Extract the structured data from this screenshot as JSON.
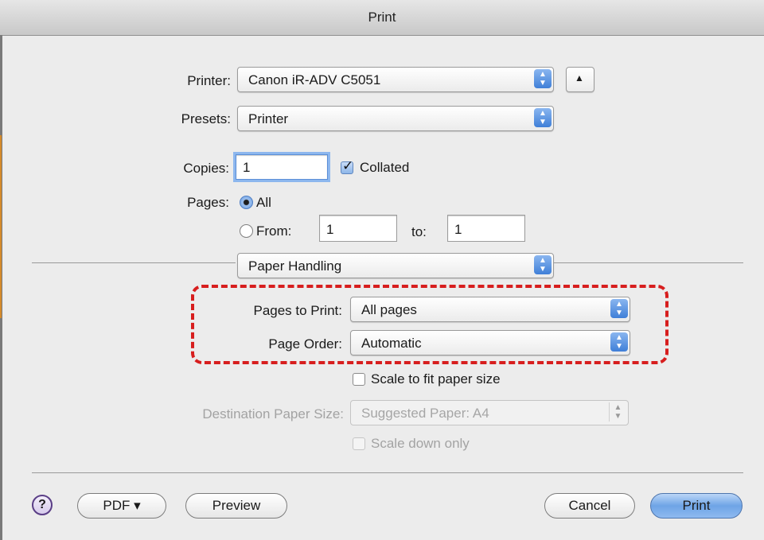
{
  "window": {
    "title": "Print"
  },
  "printer": {
    "label": "Printer:",
    "value": "Canon iR-ADV C5051",
    "disclosure_glyph": "▲"
  },
  "presets": {
    "label": "Presets:",
    "value": "Printer"
  },
  "copies": {
    "label": "Copies:",
    "value": "1",
    "collated_label": "Collated",
    "collated_checked": true
  },
  "pages": {
    "label": "Pages:",
    "all_label": "All",
    "from_label": "From:",
    "from_value": "1",
    "to_label": "to:",
    "to_value": "1",
    "selected": "All"
  },
  "panel": {
    "value": "Paper Handling"
  },
  "paper_handling": {
    "pages_to_print_label": "Pages to Print:",
    "pages_to_print_value": "All pages",
    "page_order_label": "Page Order:",
    "page_order_value": "Automatic",
    "scale_label": "Scale to fit paper size",
    "scale_checked": false,
    "dest_label": "Destination Paper Size:",
    "dest_value": "Suggested Paper: A4",
    "scale_down_label": "Scale down only",
    "scale_down_checked": false
  },
  "footer": {
    "help": "?",
    "pdf": "PDF ▾",
    "preview": "Preview",
    "cancel": "Cancel",
    "print": "Print"
  },
  "colors": {
    "highlight_dash": "#d71e1e",
    "accent": "#3f7fd8"
  }
}
